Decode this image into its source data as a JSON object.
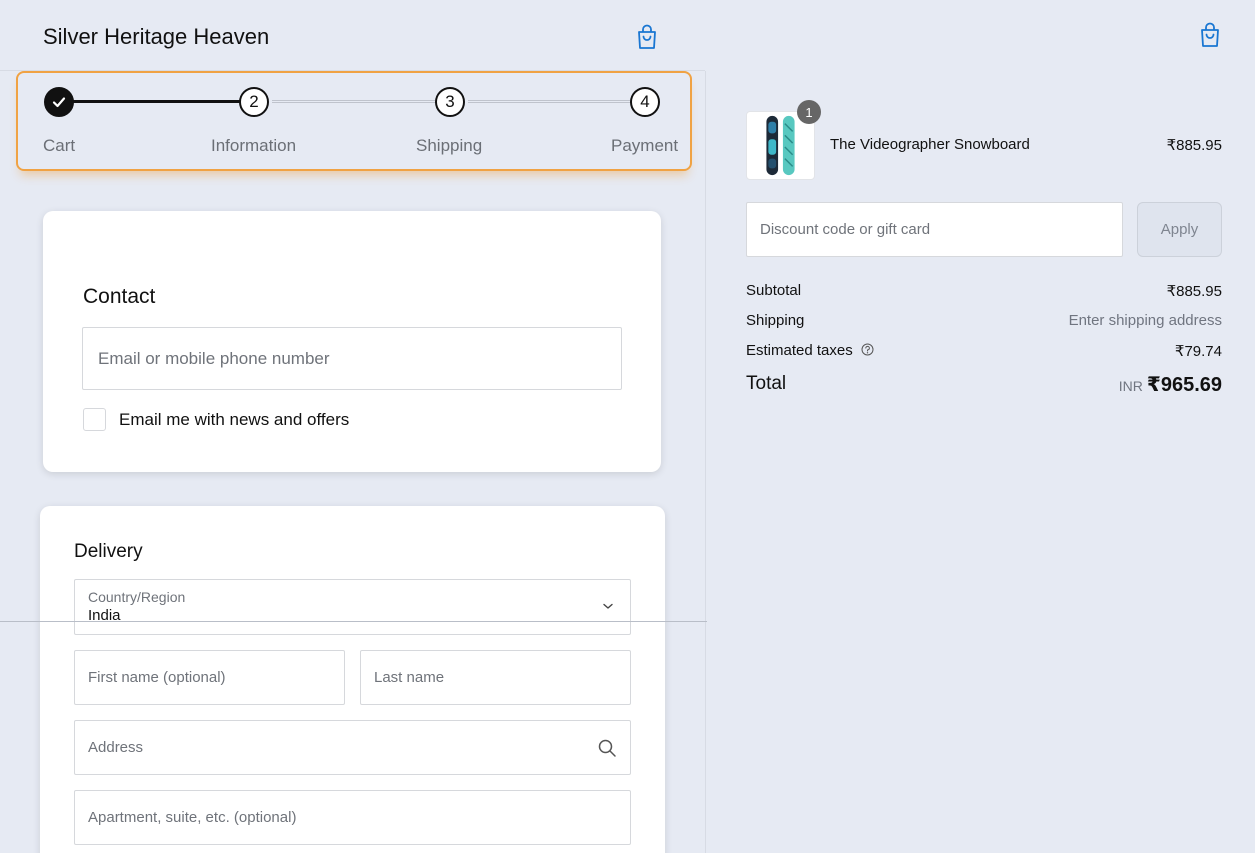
{
  "header": {
    "store_name": "Silver Heritage Heaven",
    "cart_icon": "shopping-bag-icon",
    "accent": "#1976d2"
  },
  "stepper": {
    "highlight_color": "#f0a243",
    "steps": [
      {
        "number": "",
        "label": "Cart",
        "state": "complete",
        "icon": "checkmark-icon"
      },
      {
        "number": "2",
        "label": "Information",
        "state": "current"
      },
      {
        "number": "3",
        "label": "Shipping",
        "state": "upcoming"
      },
      {
        "number": "4",
        "label": "Payment",
        "state": "upcoming"
      }
    ]
  },
  "contact": {
    "title": "Contact",
    "email_placeholder": "Email or mobile phone number",
    "newsletter_label": "Email me with news and offers",
    "newsletter_checked": false
  },
  "delivery": {
    "title": "Delivery",
    "country_caption": "Country/Region",
    "country_value": "India",
    "first_name_placeholder": "First name (optional)",
    "last_name_placeholder": "Last name",
    "address_placeholder": "Address",
    "apartment_placeholder": "Apartment, suite, etc. (optional)"
  },
  "order_summary": {
    "items": [
      {
        "quantity": "1",
        "name": "The Videographer Snowboard",
        "price": "₹885.95"
      }
    ],
    "discount_placeholder": "Discount code or gift card",
    "apply_label": "Apply",
    "subtotal_label": "Subtotal",
    "subtotal_value": "₹885.95",
    "shipping_label": "Shipping",
    "shipping_value": "Enter shipping address",
    "taxes_label": "Estimated taxes",
    "taxes_value": "₹79.74",
    "total_label": "Total",
    "total_currency": "INR",
    "total_value": "₹965.69"
  }
}
